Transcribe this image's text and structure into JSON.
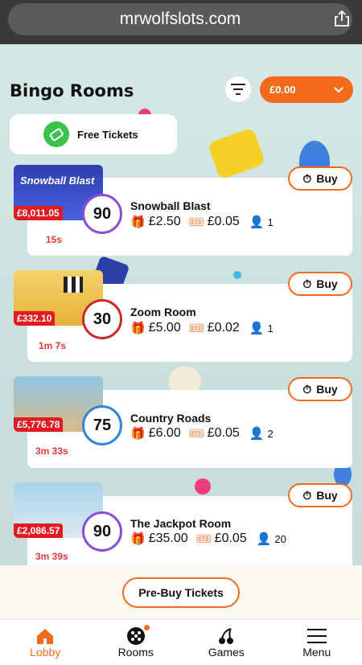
{
  "browser": {
    "url": "mrwolfslots.com"
  },
  "header": {
    "title": "Bingo Rooms",
    "balance": "£0.00"
  },
  "free_tickets": {
    "label": "Free Tickets"
  },
  "rooms": [
    {
      "name": "Snowball Blast",
      "jackpot": "£8,011.05",
      "ball": "90",
      "ticket_price": "£2.50",
      "card_price": "£0.05",
      "players": "1",
      "timer": "15s",
      "buy": "Buy",
      "thumb_text": "Snowball Blast"
    },
    {
      "name": "Zoom Room",
      "jackpot": "£332.10",
      "ball": "30",
      "ticket_price": "£5.00",
      "card_price": "£0.02",
      "players": "1",
      "timer": "1m 7s",
      "buy": "Buy"
    },
    {
      "name": "Country Roads",
      "jackpot": "£5,776.78",
      "ball": "75",
      "ticket_price": "£6.00",
      "card_price": "£0.05",
      "players": "2",
      "timer": "3m 33s",
      "buy": "Buy"
    },
    {
      "name": "The Jackpot Room",
      "jackpot": "£2,086.57",
      "ball": "90",
      "ticket_price": "£35.00",
      "card_price": "£0.05",
      "players": "20",
      "timer": "3m 39s",
      "buy": "Buy"
    }
  ],
  "prebuy": {
    "label": "Pre-Buy Tickets"
  },
  "nav": [
    {
      "label": "Lobby",
      "icon": "house-icon"
    },
    {
      "label": "Rooms",
      "icon": "bingo-ball-icon"
    },
    {
      "label": "Games",
      "icon": "cherries-icon"
    },
    {
      "label": "Menu",
      "icon": "hamburger-icon"
    }
  ],
  "colors": {
    "accent": "#f26a1b",
    "jackpot": "#e11b22",
    "timer": "#e03a3a",
    "free_ticket": "#3cc24a"
  }
}
